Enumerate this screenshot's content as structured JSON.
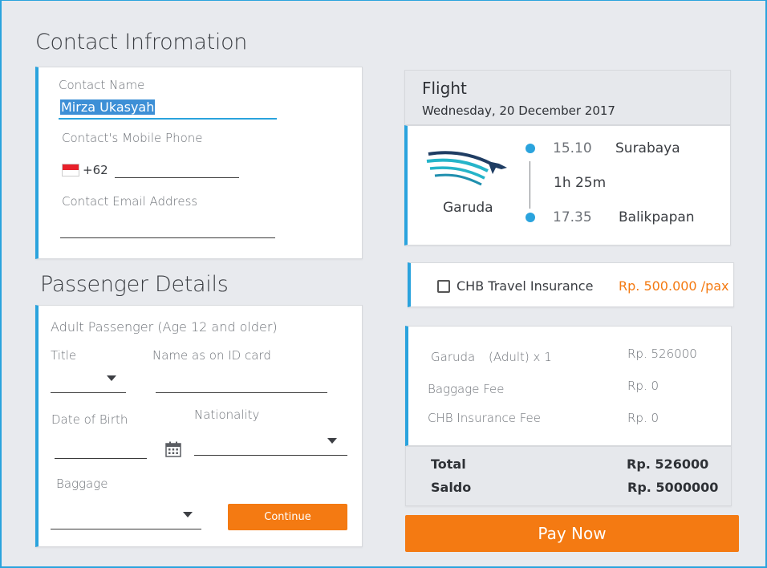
{
  "contact": {
    "title": "Contact Infromation",
    "name_label": "Contact Name",
    "name_value": "Mirza Ukasyah",
    "phone_label": "Contact's Mobile Phone",
    "phone_prefix": "+62",
    "email_label": "Contact Email Address"
  },
  "passenger": {
    "title": "Passenger Details",
    "subtitle": "Adult Passenger (Age 12 and older)",
    "title_label": "Title",
    "name_label": "Name as on ID card",
    "dob_label": "Date of Birth",
    "nationality_label": "Nationality",
    "baggage_label": "Baggage",
    "continue_label": "Continue"
  },
  "flight": {
    "header": "Flight",
    "date": "Wednesday, 20 December 2017",
    "airline": "Garuda",
    "depart_time": "15.10",
    "depart_city": "Surabaya",
    "duration": "1h 25m",
    "arrive_time": "17.35",
    "arrive_city": "Balikpapan"
  },
  "insurance": {
    "label": "CHB Travel Insurance",
    "price": "Rp. 500.000 /pax"
  },
  "summary": {
    "rows": [
      {
        "label": "Garuda",
        "qty": "(Adult) x 1",
        "value": "Rp. 526000"
      },
      {
        "label": "Baggage Fee",
        "value": "Rp. 0"
      },
      {
        "label": "CHB Insurance Fee",
        "value": "Rp. 0"
      }
    ],
    "total_label": "Total",
    "total_value": "Rp. 526000",
    "saldo_label": "Saldo",
    "saldo_value": "Rp. 5000000"
  },
  "pay_label": "Pay Now",
  "colors": {
    "accent": "#2aa3dd",
    "orange": "#f47a12"
  }
}
